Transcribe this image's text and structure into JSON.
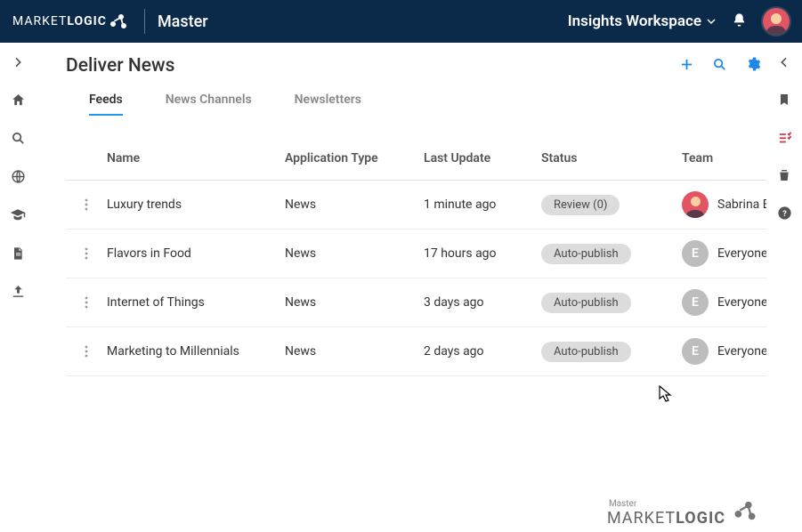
{
  "header": {
    "brand_first": "MARKET",
    "brand_second": "LOGIC",
    "context": "Master",
    "workspace": "Insights Workspace"
  },
  "page": {
    "title": "Deliver News"
  },
  "tabs": [
    {
      "label": "Feeds",
      "active": true
    },
    {
      "label": "News Channels",
      "active": false
    },
    {
      "label": "Newsletters",
      "active": false
    }
  ],
  "columns": {
    "name": "Name",
    "app_type": "Application Type",
    "last_update": "Last Update",
    "status": "Status",
    "team": "Team"
  },
  "rows": [
    {
      "name": "Luxury trends",
      "app_type": "News",
      "last_update": "1 minute ago",
      "status": "Review (0)",
      "team_label": "Sabrina E",
      "avatar_kind": "person",
      "avatar_letter": ""
    },
    {
      "name": "Flavors in Food",
      "app_type": "News",
      "last_update": "17 hours ago",
      "status": "Auto-publish",
      "team_label": "Everyone",
      "avatar_kind": "letter",
      "avatar_letter": "E"
    },
    {
      "name": "Internet of Things",
      "app_type": "News",
      "last_update": "3 days ago",
      "status": "Auto-publish",
      "team_label": "Everyone",
      "avatar_kind": "letter",
      "avatar_letter": "E"
    },
    {
      "name": "Marketing to Millennials",
      "app_type": "News",
      "last_update": "2 days ago",
      "status": "Auto-publish",
      "team_label": "Everyone",
      "avatar_kind": "letter",
      "avatar_letter": "E"
    }
  ],
  "left_nav_icons": [
    "chevron-right-icon",
    "home-icon",
    "search-icon",
    "globe-icon",
    "graduation-cap-icon",
    "document-icon",
    "upload-icon"
  ],
  "right_nav_icons": [
    "chevron-left-icon",
    "bookmark-icon",
    "checklist-icon",
    "trash-icon",
    "help-icon"
  ],
  "footer": {
    "small": "Master",
    "brand_first": "MARKET",
    "brand_second": "LOGIC"
  }
}
